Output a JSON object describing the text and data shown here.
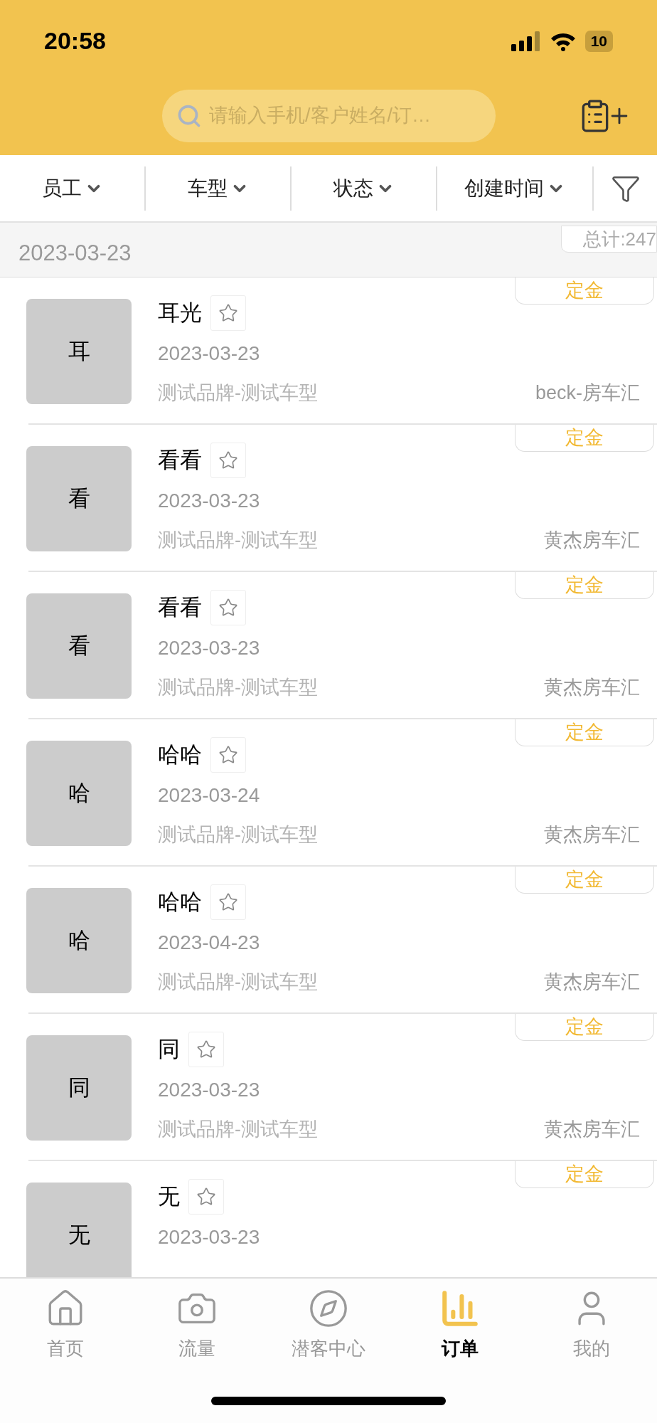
{
  "status_bar": {
    "time": "20:58",
    "battery": "10"
  },
  "search": {
    "placeholder": "请输入手机/客户姓名/订…"
  },
  "filters": [
    {
      "label": "员工"
    },
    {
      "label": "车型"
    },
    {
      "label": "状态"
    },
    {
      "label": "创建时间"
    }
  ],
  "group": {
    "date": "2023-03-23",
    "total": "总计:247"
  },
  "orders": [
    {
      "avatar": "耳",
      "name": "耳光",
      "date": "2023-03-23",
      "model": "测试品牌-测试车型",
      "store": "beck-房车汇",
      "status": "定金"
    },
    {
      "avatar": "看",
      "name": "看看",
      "date": "2023-03-23",
      "model": "测试品牌-测试车型",
      "store": "黄杰房车汇",
      "status": "定金"
    },
    {
      "avatar": "看",
      "name": "看看",
      "date": "2023-03-23",
      "model": "测试品牌-测试车型",
      "store": "黄杰房车汇",
      "status": "定金"
    },
    {
      "avatar": "哈",
      "name": "哈哈",
      "date": "2023-03-24",
      "model": "测试品牌-测试车型",
      "store": "黄杰房车汇",
      "status": "定金"
    },
    {
      "avatar": "哈",
      "name": "哈哈",
      "date": "2023-04-23",
      "model": "测试品牌-测试车型",
      "store": "黄杰房车汇",
      "status": "定金"
    },
    {
      "avatar": "同",
      "name": "同",
      "date": "2023-03-23",
      "model": "测试品牌-测试车型",
      "store": "黄杰房车汇",
      "status": "定金"
    },
    {
      "avatar": "无",
      "name": "无",
      "date": "2023-03-23",
      "status": "定金"
    }
  ],
  "tabs": [
    {
      "label": "首页",
      "selected": false
    },
    {
      "label": "流量",
      "selected": false
    },
    {
      "label": "潜客中心",
      "selected": false
    },
    {
      "label": "订单",
      "selected": true
    },
    {
      "label": "我的",
      "selected": false
    }
  ]
}
